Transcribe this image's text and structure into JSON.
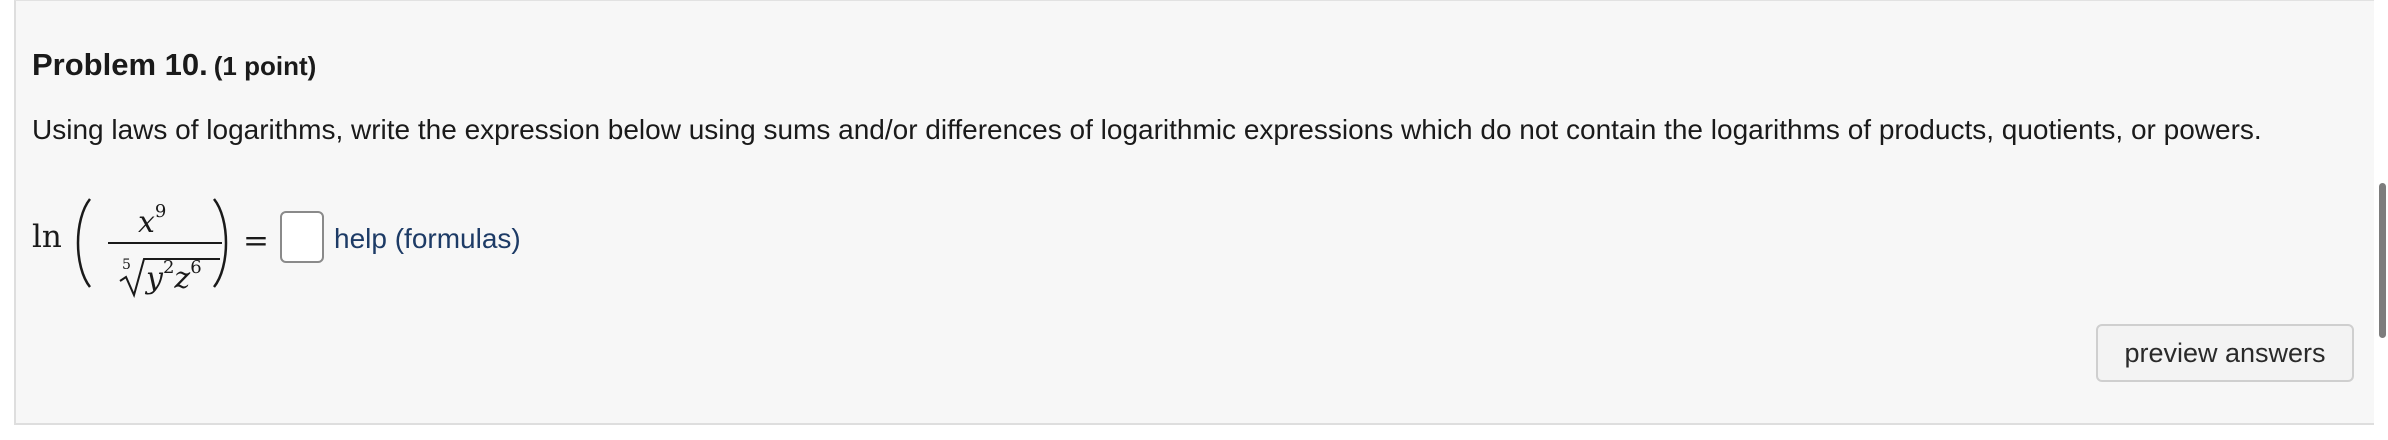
{
  "problem": {
    "title": "Problem 10.",
    "points": "(1 point)",
    "instructions": "Using laws of logarithms, write the expression below using sums and/or differences of logarithmic expressions which do not contain the logarithms of products, quotients, or powers."
  },
  "expression": {
    "function": "ln",
    "numerator_base": "x",
    "numerator_exponent": "9",
    "root_index": "5",
    "denominator_var1": "y",
    "denominator_exp1": "2",
    "denominator_var2": "z",
    "denominator_exp2": "6",
    "equals": "="
  },
  "answer": {
    "value": "",
    "placeholder": ""
  },
  "help_link": "help (formulas)",
  "preview_button": "preview answers",
  "colors": {
    "panel_bg": "#f7f7f7",
    "link": "#1d3b66",
    "button_bg": "#f3f3f3"
  }
}
